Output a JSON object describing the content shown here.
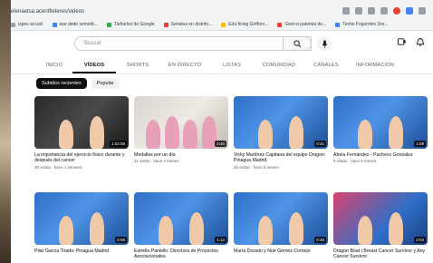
{
  "browser": {
    "url": "elenaetsa.acentfieteres/videos",
    "bookmarks": [
      {
        "label": "ispes accus!",
        "color": "#9aa0a6"
      },
      {
        "label": "ase dede semetti...",
        "color": "#4285f4"
      },
      {
        "label": "Tieñarles de Google",
        "color": "#34a853"
      },
      {
        "label": "Senatus en distrito...",
        "color": "#ea4335"
      },
      {
        "label": "Eda ficing Geffreo...",
        "color": "#fbbc05"
      },
      {
        "label": "Gest w patemia de...",
        "color": "#ea4335"
      },
      {
        "label": "Tentio Frigondes Dor...",
        "color": "#4285f4"
      }
    ]
  },
  "header": {
    "search_placeholder": "Buscar"
  },
  "tabs": [
    {
      "label": "INICIO",
      "active": false
    },
    {
      "label": "VÍDEOS",
      "active": true
    },
    {
      "label": "SHORTS",
      "active": false
    },
    {
      "label": "EN DIRECTO",
      "active": false
    },
    {
      "label": "LISTAS",
      "active": false
    },
    {
      "label": "COMUNIDAD",
      "active": false
    },
    {
      "label": "CANALES",
      "active": false
    },
    {
      "label": "INFORMACIÓN",
      "active": false
    }
  ],
  "chips": [
    {
      "label": "Subidos recientes",
      "active": true
    },
    {
      "label": "Popular",
      "active": false
    }
  ],
  "videos": [
    {
      "title": "La importancia del ejercicio físico durante y después del cancer",
      "meta": "30 vistas · hace 1 semana",
      "duration": "1:02:08",
      "thumb": "t-dark"
    },
    {
      "title": "Medallas por un día",
      "meta": "11 vistas · hace 4 meses",
      "duration": "4:40",
      "thumb": "t-light"
    },
    {
      "title": "Vicky Martínez Capitana del equipo Dragon: Pinagua Madrid",
      "meta": "26 vistas · hace 5 meses",
      "duration": "0:41",
      "thumb": "t-blue"
    },
    {
      "title": "Abela Fernández - Pacheco Gonzalez",
      "meta": "9 vistas · hace 5 meses",
      "duration": "1:08",
      "thumb": "t-blue"
    },
    {
      "title": "Pilar Garcia Tirado: Pinagua Madrid",
      "meta": "",
      "duration": "0:58",
      "thumb": "t-blue"
    },
    {
      "title": "Estrella Paniello: Directora de Proyectos Asociacionales",
      "meta": "",
      "duration": "1:12",
      "thumb": "t-blue"
    },
    {
      "title": "María Dorado y Noé Gómez Cornejo",
      "meta": "",
      "duration": "0:45",
      "thumb": "t-blue"
    },
    {
      "title": "Dragon Boat | Breast Cancer Survivor y Any Cancer Survivor",
      "meta": "",
      "duration": "2:04",
      "thumb": "t-pink"
    }
  ]
}
